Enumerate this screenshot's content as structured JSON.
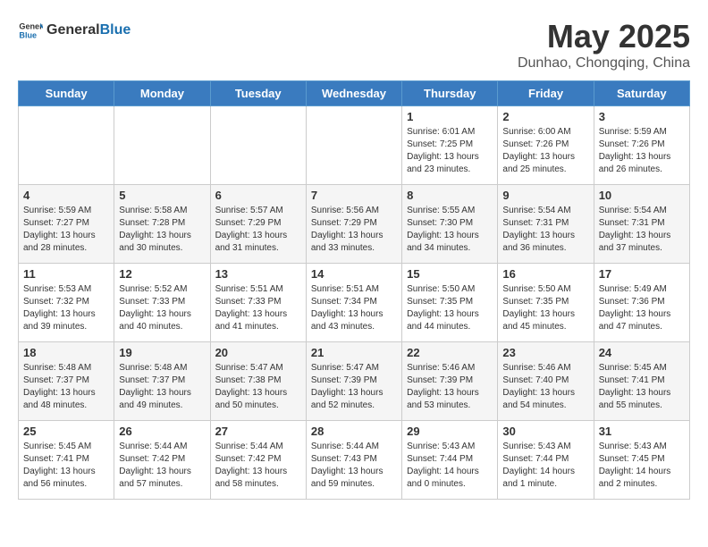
{
  "header": {
    "logo_general": "General",
    "logo_blue": "Blue",
    "title": "May 2025",
    "subtitle": "Dunhao, Chongqing, China"
  },
  "days_of_week": [
    "Sunday",
    "Monday",
    "Tuesday",
    "Wednesday",
    "Thursday",
    "Friday",
    "Saturday"
  ],
  "weeks": [
    [
      {
        "day": "",
        "info": ""
      },
      {
        "day": "",
        "info": ""
      },
      {
        "day": "",
        "info": ""
      },
      {
        "day": "",
        "info": ""
      },
      {
        "day": "1",
        "info": "Sunrise: 6:01 AM\nSunset: 7:25 PM\nDaylight: 13 hours\nand 23 minutes."
      },
      {
        "day": "2",
        "info": "Sunrise: 6:00 AM\nSunset: 7:26 PM\nDaylight: 13 hours\nand 25 minutes."
      },
      {
        "day": "3",
        "info": "Sunrise: 5:59 AM\nSunset: 7:26 PM\nDaylight: 13 hours\nand 26 minutes."
      }
    ],
    [
      {
        "day": "4",
        "info": "Sunrise: 5:59 AM\nSunset: 7:27 PM\nDaylight: 13 hours\nand 28 minutes."
      },
      {
        "day": "5",
        "info": "Sunrise: 5:58 AM\nSunset: 7:28 PM\nDaylight: 13 hours\nand 30 minutes."
      },
      {
        "day": "6",
        "info": "Sunrise: 5:57 AM\nSunset: 7:29 PM\nDaylight: 13 hours\nand 31 minutes."
      },
      {
        "day": "7",
        "info": "Sunrise: 5:56 AM\nSunset: 7:29 PM\nDaylight: 13 hours\nand 33 minutes."
      },
      {
        "day": "8",
        "info": "Sunrise: 5:55 AM\nSunset: 7:30 PM\nDaylight: 13 hours\nand 34 minutes."
      },
      {
        "day": "9",
        "info": "Sunrise: 5:54 AM\nSunset: 7:31 PM\nDaylight: 13 hours\nand 36 minutes."
      },
      {
        "day": "10",
        "info": "Sunrise: 5:54 AM\nSunset: 7:31 PM\nDaylight: 13 hours\nand 37 minutes."
      }
    ],
    [
      {
        "day": "11",
        "info": "Sunrise: 5:53 AM\nSunset: 7:32 PM\nDaylight: 13 hours\nand 39 minutes."
      },
      {
        "day": "12",
        "info": "Sunrise: 5:52 AM\nSunset: 7:33 PM\nDaylight: 13 hours\nand 40 minutes."
      },
      {
        "day": "13",
        "info": "Sunrise: 5:51 AM\nSunset: 7:33 PM\nDaylight: 13 hours\nand 41 minutes."
      },
      {
        "day": "14",
        "info": "Sunrise: 5:51 AM\nSunset: 7:34 PM\nDaylight: 13 hours\nand 43 minutes."
      },
      {
        "day": "15",
        "info": "Sunrise: 5:50 AM\nSunset: 7:35 PM\nDaylight: 13 hours\nand 44 minutes."
      },
      {
        "day": "16",
        "info": "Sunrise: 5:50 AM\nSunset: 7:35 PM\nDaylight: 13 hours\nand 45 minutes."
      },
      {
        "day": "17",
        "info": "Sunrise: 5:49 AM\nSunset: 7:36 PM\nDaylight: 13 hours\nand 47 minutes."
      }
    ],
    [
      {
        "day": "18",
        "info": "Sunrise: 5:48 AM\nSunset: 7:37 PM\nDaylight: 13 hours\nand 48 minutes."
      },
      {
        "day": "19",
        "info": "Sunrise: 5:48 AM\nSunset: 7:37 PM\nDaylight: 13 hours\nand 49 minutes."
      },
      {
        "day": "20",
        "info": "Sunrise: 5:47 AM\nSunset: 7:38 PM\nDaylight: 13 hours\nand 50 minutes."
      },
      {
        "day": "21",
        "info": "Sunrise: 5:47 AM\nSunset: 7:39 PM\nDaylight: 13 hours\nand 52 minutes."
      },
      {
        "day": "22",
        "info": "Sunrise: 5:46 AM\nSunset: 7:39 PM\nDaylight: 13 hours\nand 53 minutes."
      },
      {
        "day": "23",
        "info": "Sunrise: 5:46 AM\nSunset: 7:40 PM\nDaylight: 13 hours\nand 54 minutes."
      },
      {
        "day": "24",
        "info": "Sunrise: 5:45 AM\nSunset: 7:41 PM\nDaylight: 13 hours\nand 55 minutes."
      }
    ],
    [
      {
        "day": "25",
        "info": "Sunrise: 5:45 AM\nSunset: 7:41 PM\nDaylight: 13 hours\nand 56 minutes."
      },
      {
        "day": "26",
        "info": "Sunrise: 5:44 AM\nSunset: 7:42 PM\nDaylight: 13 hours\nand 57 minutes."
      },
      {
        "day": "27",
        "info": "Sunrise: 5:44 AM\nSunset: 7:42 PM\nDaylight: 13 hours\nand 58 minutes."
      },
      {
        "day": "28",
        "info": "Sunrise: 5:44 AM\nSunset: 7:43 PM\nDaylight: 13 hours\nand 59 minutes."
      },
      {
        "day": "29",
        "info": "Sunrise: 5:43 AM\nSunset: 7:44 PM\nDaylight: 14 hours\nand 0 minutes."
      },
      {
        "day": "30",
        "info": "Sunrise: 5:43 AM\nSunset: 7:44 PM\nDaylight: 14 hours\nand 1 minute."
      },
      {
        "day": "31",
        "info": "Sunrise: 5:43 AM\nSunset: 7:45 PM\nDaylight: 14 hours\nand 2 minutes."
      }
    ]
  ]
}
